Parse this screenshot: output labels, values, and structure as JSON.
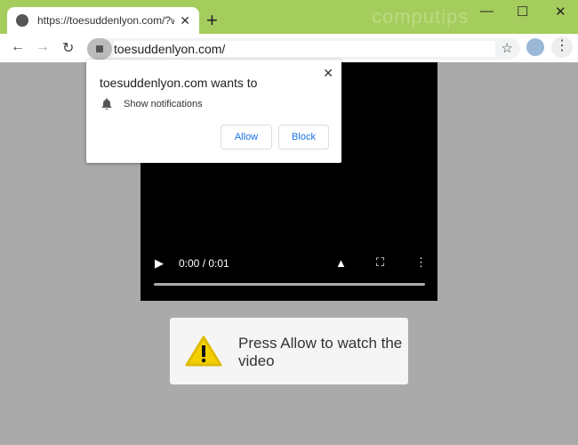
{
  "browser": {
    "tab_title": "https://toesuddenlyon.com/?wmi",
    "url": "toesuddenlyon.com/",
    "watermark": "computips",
    "new_tab": "+",
    "tab_close": "✕",
    "minimize": "—",
    "maximize": "☐",
    "close": "✕",
    "back": "←",
    "forward": "→",
    "reload": "↻",
    "star": "☆",
    "menu": "⋮"
  },
  "popup": {
    "title": "toesuddenlyon.com wants to",
    "permission": "Show notifications",
    "allow": "Allow",
    "block": "Block",
    "close": "✕",
    "bell": "🔔"
  },
  "video": {
    "time": "0:00 / 0:01",
    "play": "▶",
    "volume": "🔊",
    "fullscreen": "⛶",
    "more": "⋮",
    "progress": 0
  },
  "message": {
    "text": "Press Allow to watch the video"
  },
  "colors": {
    "titlebar": "#a5cd5e",
    "page_bg": "#aaaaaa",
    "accent": "#1a73e8"
  }
}
